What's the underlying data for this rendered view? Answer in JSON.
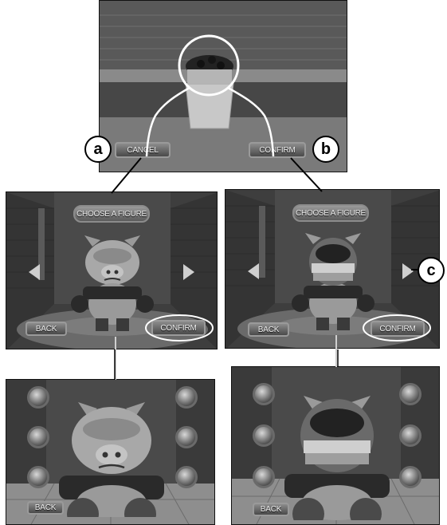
{
  "callouts": {
    "a": "a",
    "b": "b",
    "c": "c"
  },
  "top_panel": {
    "cancel_label": "CANCEL",
    "confirm_label": "CONFIRM"
  },
  "select_left": {
    "title": "CHOOSE A FIGURE",
    "back_label": "BACK",
    "confirm_label": "CONFIRM"
  },
  "select_right": {
    "title": "CHOOSE A FIGURE",
    "back_label": "BACK",
    "confirm_label": "CONFIRM"
  },
  "game_left": {
    "back_label": "BACK"
  },
  "game_right": {
    "back_label": "BACK"
  },
  "icons": {
    "power_orbs": [
      "hand-icon",
      "lightning-icon",
      "fist-icon",
      "fire-icon",
      "speaker-icon",
      "spiral-icon"
    ],
    "character": "monster-figure",
    "face_overlay": "photo-face-icon"
  }
}
